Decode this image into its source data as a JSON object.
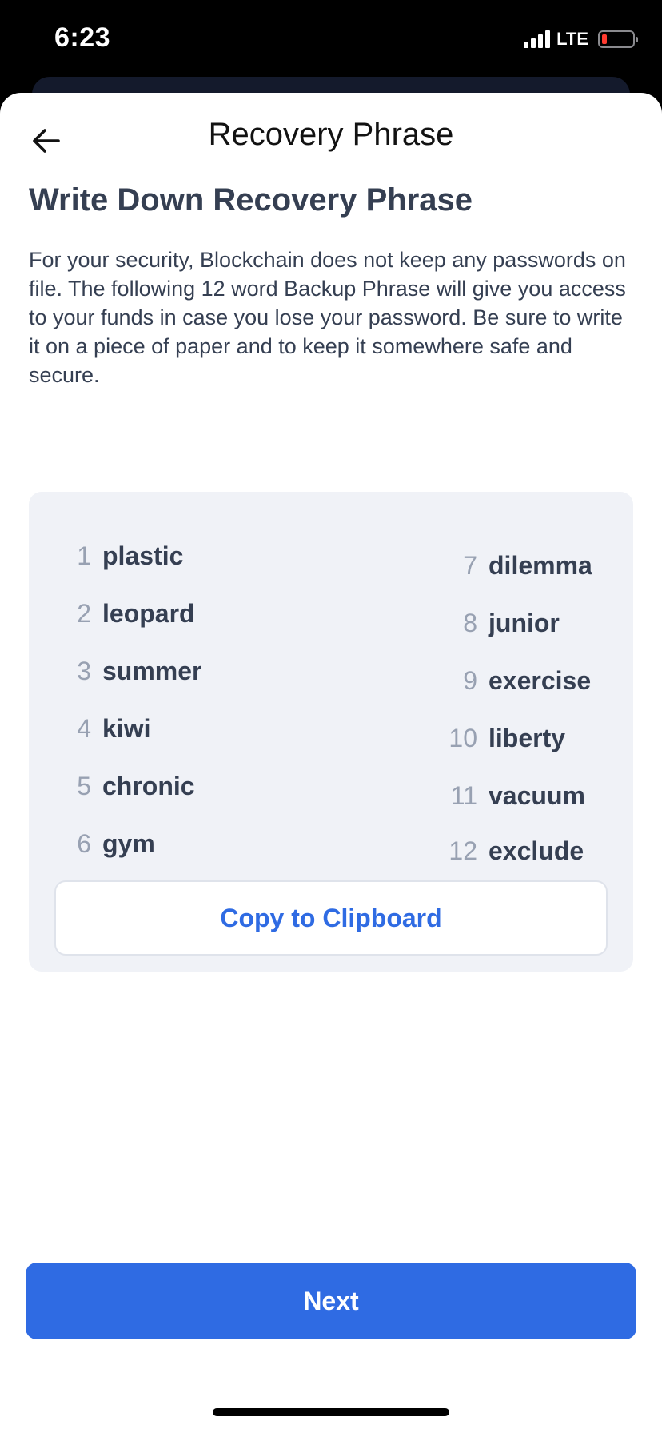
{
  "status_bar": {
    "time": "6:23",
    "network": "LTE",
    "colors": {
      "battery_low": "#ff3b30"
    }
  },
  "header": {
    "title": "Recovery Phrase",
    "back_icon": "arrow-left-icon"
  },
  "content": {
    "heading": "Write Down Recovery Phrase",
    "description": "For your security, Blockchain does not keep any passwords on file. The following 12 word Backup Phrase will give you access to your funds in case you lose your password. Be sure to write it on a piece of paper and to keep it somewhere safe and secure."
  },
  "phrase": {
    "left": [
      {
        "index": "1",
        "word": "plastic"
      },
      {
        "index": "2",
        "word": "leopard"
      },
      {
        "index": "3",
        "word": "summer"
      },
      {
        "index": "4",
        "word": "kiwi"
      },
      {
        "index": "5",
        "word": "chronic"
      },
      {
        "index": "6",
        "word": "gym"
      }
    ],
    "right": [
      {
        "index": "7",
        "word": "dilemma"
      },
      {
        "index": "8",
        "word": "junior"
      },
      {
        "index": "9",
        "word": "exercise"
      },
      {
        "index": "10",
        "word": "liberty"
      },
      {
        "index": "11",
        "word": "vacuum"
      },
      {
        "index": "12",
        "word": "exclude"
      }
    ],
    "copy_label": "Copy to Clipboard"
  },
  "footer": {
    "next_label": "Next"
  },
  "colors": {
    "accent": "#2f6be3",
    "text_primary": "#353f52",
    "text_muted": "#98a1b2",
    "card_background": "#f0f2f7"
  }
}
